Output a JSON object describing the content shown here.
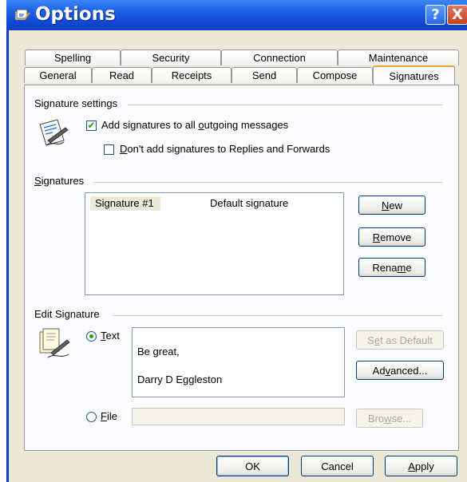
{
  "window": {
    "title": "Options",
    "help_label": "?",
    "close_label": "X"
  },
  "tabs_back": [
    "Spelling",
    "Security",
    "Connection",
    "Maintenance"
  ],
  "tabs_front": [
    "General",
    "Read",
    "Receipts",
    "Send",
    "Compose",
    "Signatures"
  ],
  "signature_settings": {
    "heading": "Signature settings",
    "add_to_all": {
      "pre": "Add signatures to all ",
      "accel": "o",
      "post": "utgoing messages",
      "checked": true
    },
    "no_replies": {
      "accel": "D",
      "post": "on't add signatures to Replies and Forwards",
      "checked": false
    }
  },
  "signatures": {
    "heading_accel": "S",
    "heading_rest": "ignatures",
    "rows": [
      {
        "name": "Signature #1",
        "note": "Default signature"
      }
    ],
    "new": {
      "accel": "N",
      "rest": "ew"
    },
    "remove": {
      "accel": "R",
      "rest": "emove"
    },
    "rename": {
      "pre": "Rena",
      "accel": "m",
      "post": "e"
    }
  },
  "edit_signature": {
    "heading": "Edit Signature",
    "text_option": {
      "accel": "T",
      "rest": "ext",
      "selected": true
    },
    "text_lines": [
      "Be great,",
      "Darry D Eggleston"
    ],
    "set_default": {
      "pre": "S",
      "accel": "e",
      "post": "t as Default"
    },
    "advanced": {
      "pre": "Ad",
      "accel": "v",
      "post": "anced..."
    },
    "file_option": {
      "accel": "F",
      "rest": "ile",
      "selected": false
    },
    "file_path": "",
    "browse": {
      "pre": "Bro",
      "accel": "w",
      "post": "se..."
    }
  },
  "footer": {
    "ok": "OK",
    "cancel": "Cancel",
    "apply": {
      "accel": "A",
      "rest": "pply"
    }
  },
  "colors": {
    "title_blue": "#1f62e6",
    "face": "#ece9d8",
    "check_green": "#21a121",
    "tab_highlight": "#f2a52c"
  }
}
